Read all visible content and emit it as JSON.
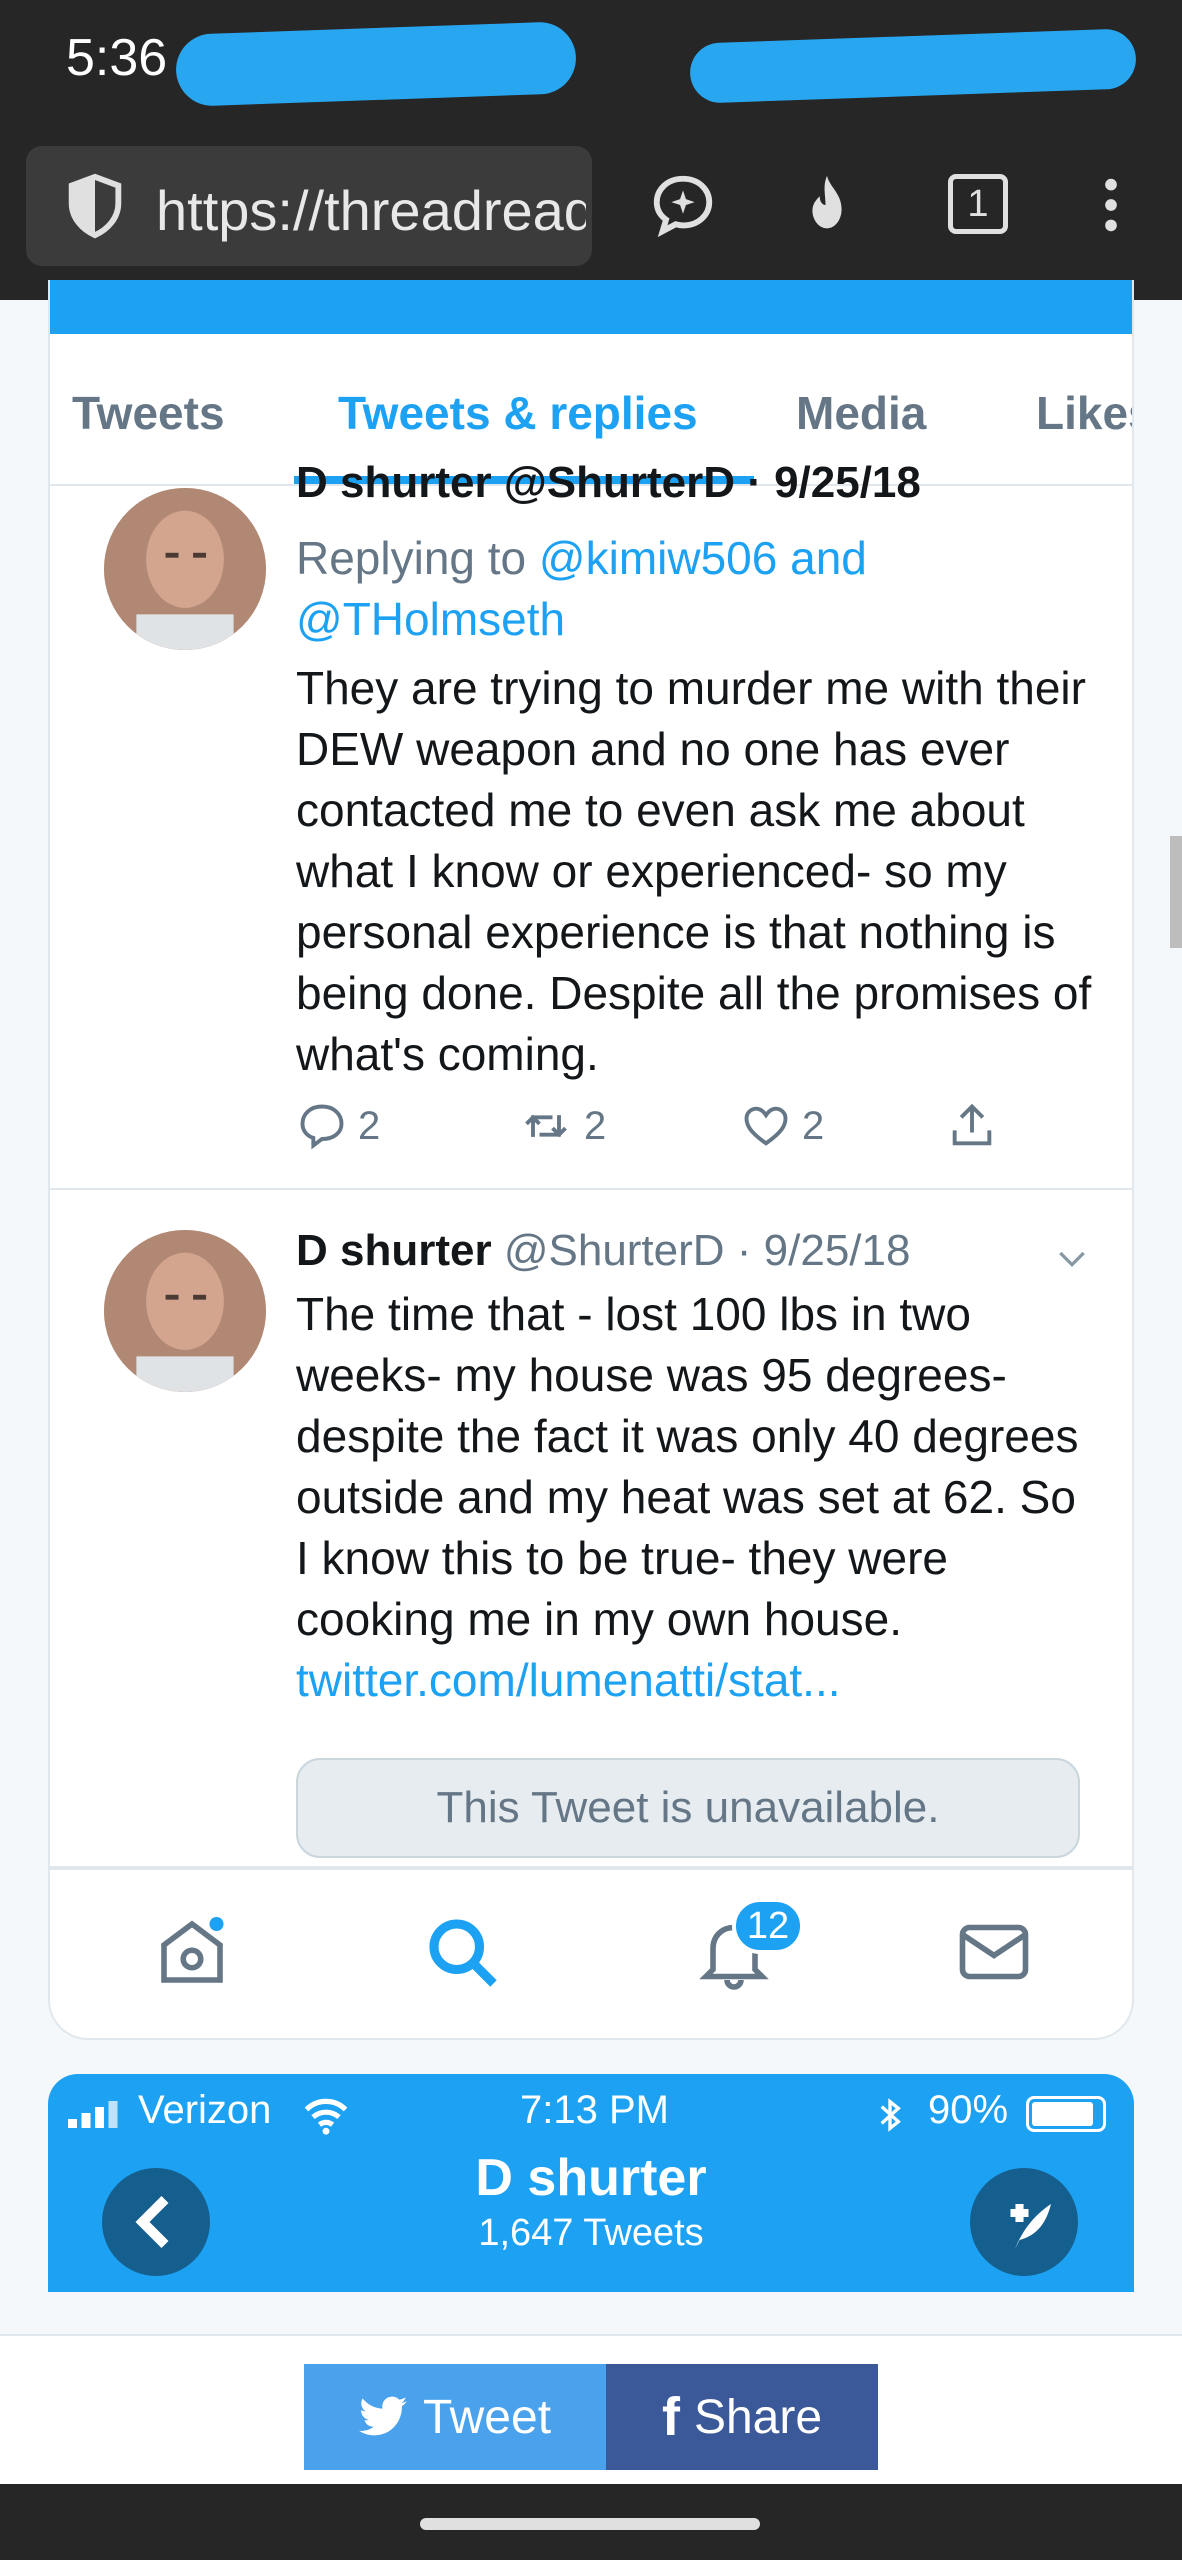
{
  "status_bar": {
    "time": "5:36"
  },
  "browser": {
    "url": "https://threadreaderapp.com",
    "tab_count": "1"
  },
  "profile_tabs": [
    {
      "label": "Tweets",
      "active": false
    },
    {
      "label": "Tweets & replies",
      "active": true
    },
    {
      "label": "Media",
      "active": false
    },
    {
      "label": "Likes",
      "active": false
    }
  ],
  "tweets": [
    {
      "header_partial": "D shurter @ShurterD · 9/25/18",
      "replying_label": "Replying to",
      "reply_to_1": "@kimiw506 and",
      "reply_to_2": "@THolmseth",
      "text": "They are trying to murder me with their DEW weapon and no one has ever contacted me to even ask me about what I know or experienced- so my personal experience is that nothing is being done. Despite all the promises of what's coming.",
      "replies": "2",
      "retweets": "2",
      "likes": "2"
    },
    {
      "name": "D shurter",
      "handle": "@ShurterD · 9/25/18",
      "text": "The time that - lost 100 lbs in two weeks- my house was 95 degrees- despite the fact it was only 40 degrees outside and my heat was set at 62. So I know this to be true- they were cooking me in my own house.",
      "link": "twitter.com/lumenatti/stat...",
      "quoted_unavailable": "This Tweet is unavailable."
    }
  ],
  "bottom_nav": {
    "notifications_count": "12"
  },
  "ios_header": {
    "carrier": "Verizon",
    "time": "7:13 PM",
    "battery": "90%",
    "title": "D shurter",
    "subtitle": "1,647 Tweets"
  },
  "share": {
    "tweet_label": "Tweet",
    "share_label": "Share"
  },
  "colors": {
    "twitter_blue": "#1da1f2",
    "facebook_blue": "#3b5998",
    "dark_bar": "#262626"
  }
}
